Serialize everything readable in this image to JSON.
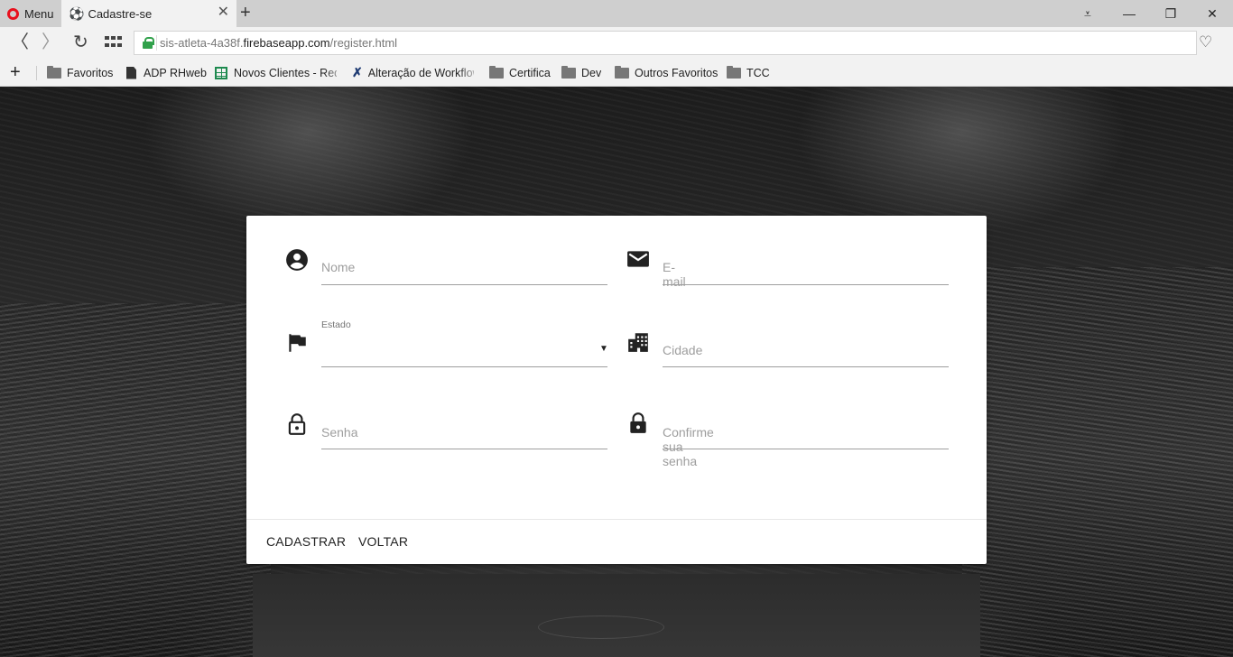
{
  "browser": {
    "menu_label": "Menu",
    "tab": {
      "title": "Cadastre-se",
      "favicon": "⚽",
      "close": "✕"
    },
    "new_tab": "+",
    "window_controls": {
      "menu": "⩡",
      "minimize": "—",
      "restore": "❐",
      "close": "✕"
    },
    "nav": {
      "back": "〈",
      "forward": "〉",
      "reload": "↻"
    },
    "url": {
      "prefix": "sis-atleta-4a38f.",
      "host": "firebaseapp.com",
      "path": "/register.html"
    },
    "heart": "♡",
    "bookmarks": {
      "add": "+",
      "items": [
        {
          "label": "Favoritos",
          "icon": "folder-icon"
        },
        {
          "label": "ADP RHweb",
          "icon": "document-icon"
        },
        {
          "label": "Novos Clientes - Rede",
          "icon": "spreadsheet-icon"
        },
        {
          "label": "Alteração de Workflow",
          "icon": "x-tool-icon"
        },
        {
          "label": "Certifica",
          "icon": "folder-icon"
        },
        {
          "label": "Dev",
          "icon": "folder-icon"
        },
        {
          "label": "Outros Favoritos",
          "icon": "folder-icon"
        },
        {
          "label": "TCC",
          "icon": "folder-icon"
        }
      ]
    }
  },
  "form": {
    "nome": {
      "placeholder": "Nome",
      "icon": "account-circle-icon"
    },
    "email": {
      "placeholder": "E-mail",
      "icon": "mail-icon"
    },
    "estado": {
      "label": "Estado",
      "value": "",
      "icon": "flag-icon",
      "arrow": "▼"
    },
    "cidade": {
      "placeholder": "Cidade",
      "icon": "city-icon"
    },
    "senha": {
      "placeholder": "Senha",
      "icon": "lock-outline-icon"
    },
    "confirmar_senha": {
      "placeholder": "Confirme sua senha",
      "icon": "lock-icon"
    },
    "actions": {
      "submit": "CADASTRAR",
      "back": "VOLTAR"
    }
  }
}
